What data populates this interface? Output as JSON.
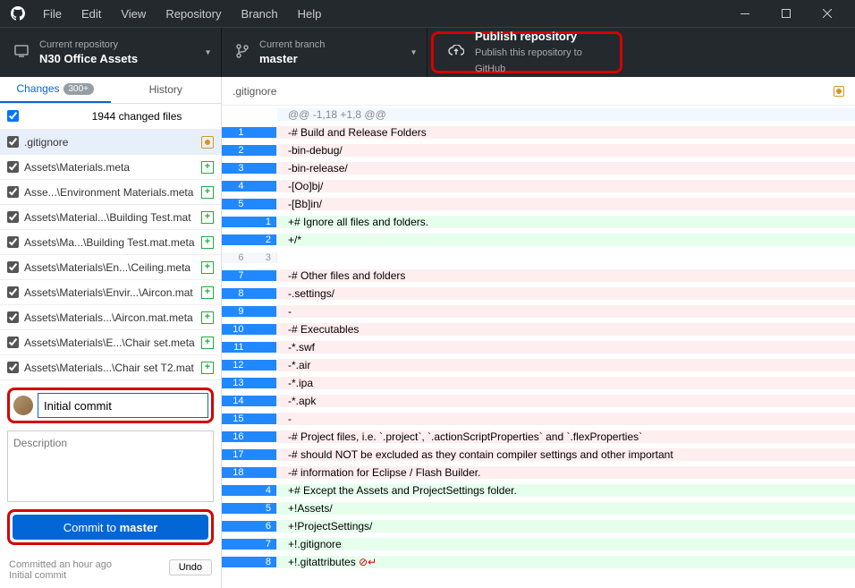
{
  "menu": [
    "File",
    "Edit",
    "View",
    "Repository",
    "Branch",
    "Help"
  ],
  "repo": {
    "label": "Current repository",
    "name": "N30 Office Assets"
  },
  "branch": {
    "label": "Current branch",
    "name": "master"
  },
  "publish": {
    "title": "Publish repository",
    "subtitle": "Publish this repository to GitHub"
  },
  "tabs": {
    "changes": "Changes",
    "changes_badge": "300+",
    "history": "History"
  },
  "summary_line": "1944 changed files",
  "files": [
    {
      "name": ".gitignore",
      "status": "mod",
      "selected": true
    },
    {
      "name": "Assets\\Materials.meta",
      "status": "add"
    },
    {
      "name": "Asse...\\Environment Materials.meta",
      "status": "add"
    },
    {
      "name": "Assets\\Material...\\Building Test.mat",
      "status": "add"
    },
    {
      "name": "Assets\\Ma...\\Building Test.mat.meta",
      "status": "add"
    },
    {
      "name": "Assets\\Materials\\En...\\Ceiling.meta",
      "status": "add"
    },
    {
      "name": "Assets\\Materials\\Envir...\\Aircon.mat",
      "status": "add"
    },
    {
      "name": "Assets\\Materials...\\Aircon.mat.meta",
      "status": "add"
    },
    {
      "name": "Assets\\Materials\\E...\\Chair set.meta",
      "status": "add"
    },
    {
      "name": "Assets\\Materials...\\Chair set T2.mat",
      "status": "add"
    }
  ],
  "commit": {
    "summary_value": "Initial commit",
    "desc_placeholder": "Description",
    "button_prefix": "Commit to ",
    "button_branch": "master"
  },
  "last_commit": {
    "time": "Committed an hour ago",
    "msg": "Initial commit",
    "undo": "Undo"
  },
  "diff": {
    "filename": ".gitignore",
    "lines": [
      {
        "t": "hunk",
        "old": "",
        "new": "",
        "c": "@@ -1,18 +1,8 @@",
        "sel": false
      },
      {
        "t": "del",
        "old": "1",
        "new": "",
        "c": "-# Build and Release Folders",
        "sel": true
      },
      {
        "t": "del",
        "old": "2",
        "new": "",
        "c": "-bin-debug/",
        "sel": true
      },
      {
        "t": "del",
        "old": "3",
        "new": "",
        "c": "-bin-release/",
        "sel": true
      },
      {
        "t": "del",
        "old": "4",
        "new": "",
        "c": "-[Oo]bj/",
        "sel": true
      },
      {
        "t": "del",
        "old": "5",
        "new": "",
        "c": "-[Bb]in/",
        "sel": true
      },
      {
        "t": "add",
        "old": "",
        "new": "1",
        "c": "+# Ignore all files and folders.",
        "sel": true
      },
      {
        "t": "add",
        "old": "",
        "new": "2",
        "c": "+/*",
        "sel": true
      },
      {
        "t": "ctx",
        "old": "6",
        "new": "3",
        "c": "",
        "sel": false
      },
      {
        "t": "del",
        "old": "7",
        "new": "",
        "c": "-# Other files and folders",
        "sel": true
      },
      {
        "t": "del",
        "old": "8",
        "new": "",
        "c": "-.settings/",
        "sel": true
      },
      {
        "t": "del",
        "old": "9",
        "new": "",
        "c": "-",
        "sel": true
      },
      {
        "t": "del",
        "old": "10",
        "new": "",
        "c": "-# Executables",
        "sel": true
      },
      {
        "t": "del",
        "old": "11",
        "new": "",
        "c": "-*.swf",
        "sel": true
      },
      {
        "t": "del",
        "old": "12",
        "new": "",
        "c": "-*.air",
        "sel": true
      },
      {
        "t": "del",
        "old": "13",
        "new": "",
        "c": "-*.ipa",
        "sel": true
      },
      {
        "t": "del",
        "old": "14",
        "new": "",
        "c": "-*.apk",
        "sel": true
      },
      {
        "t": "del",
        "old": "15",
        "new": "",
        "c": "-",
        "sel": true
      },
      {
        "t": "del",
        "old": "16",
        "new": "",
        "c": "-# Project files, i.e. `.project`, `.actionScriptProperties` and `.flexProperties`",
        "sel": true
      },
      {
        "t": "del",
        "old": "17",
        "new": "",
        "c": "-# should NOT be excluded as they contain compiler settings and other important",
        "sel": true
      },
      {
        "t": "del",
        "old": "18",
        "new": "",
        "c": "-# information for Eclipse / Flash Builder.",
        "sel": true
      },
      {
        "t": "add",
        "old": "",
        "new": "4",
        "c": "+# Except the Assets and ProjectSettings folder.",
        "sel": true
      },
      {
        "t": "add",
        "old": "",
        "new": "5",
        "c": "+!Assets/",
        "sel": true
      },
      {
        "t": "add",
        "old": "",
        "new": "6",
        "c": "+!ProjectSettings/",
        "sel": true
      },
      {
        "t": "add",
        "old": "",
        "new": "7",
        "c": "+!.gitignore",
        "sel": true
      },
      {
        "t": "add",
        "old": "",
        "new": "8",
        "c": "+!.gitattributes ",
        "sel": true,
        "eol": true
      }
    ]
  }
}
